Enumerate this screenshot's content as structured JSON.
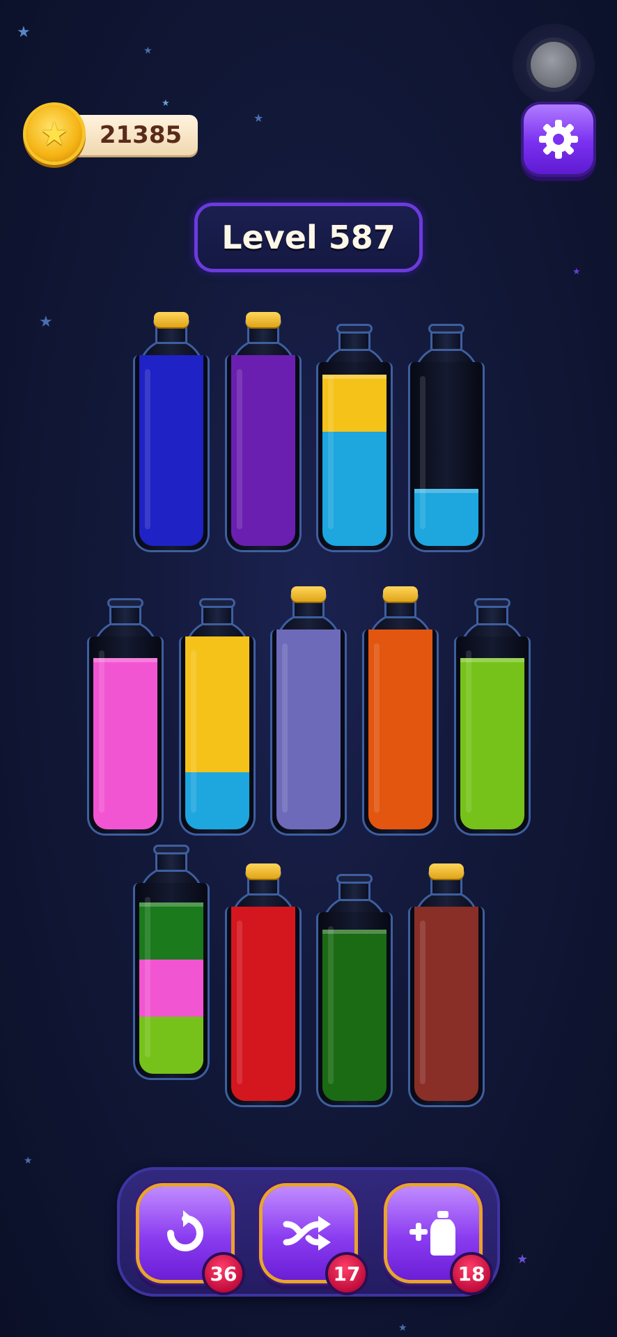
{
  "header": {
    "coins": "21385",
    "level_label": "Level 587"
  },
  "icons": {
    "coin": "star-coin-icon",
    "settings": "gear-icon",
    "undo": "undo-icon",
    "shuffle": "shuffle-icon",
    "add_bottle": "add-bottle-icon"
  },
  "tools": {
    "undo_count": "36",
    "shuffle_count": "17",
    "add_bottle_count": "18"
  },
  "bottles": [
    {
      "layers": [
        "#1f22c4",
        "#1f22c4",
        "#1f22c4",
        "#1f22c4"
      ],
      "corked": true
    },
    {
      "layers": [
        "#6a1fb0",
        "#6a1fb0",
        "#6a1fb0",
        "#6a1fb0"
      ],
      "corked": true
    },
    {
      "layers": [
        "#1ea6df",
        "#1ea6df",
        "#f5c21a"
      ],
      "corked": false
    },
    {
      "layers": [
        "#1ea6df"
      ],
      "corked": false
    },
    {
      "layers": [
        "#f255d2",
        "#f255d2",
        "#f255d2"
      ],
      "corked": false
    },
    {
      "layers": [
        "#1ea6df",
        "#f5c21a",
        "#f5c21a",
        "#f5c21a"
      ],
      "corked": false
    },
    {
      "layers": [
        "#6e6aba",
        "#6e6aba",
        "#6e6aba",
        "#6e6aba"
      ],
      "corked": true
    },
    {
      "layers": [
        "#e2560f",
        "#e2560f",
        "#e2560f",
        "#e2560f"
      ],
      "corked": true
    },
    {
      "layers": [
        "#76c21b",
        "#76c21b",
        "#76c21b"
      ],
      "corked": false
    },
    {
      "layers": [
        "#76c21b",
        "#f255d2",
        "#1b7a1c"
      ],
      "corked": false
    },
    {
      "layers": [
        "#d4161f",
        "#d4161f",
        "#d4161f",
        "#d4161f"
      ],
      "corked": true
    },
    {
      "layers": [
        "#1b6a14",
        "#1b6a14",
        "#1b6a14"
      ],
      "corked": false
    },
    {
      "layers": [
        "#8a2e28",
        "#8a2e28",
        "#8a2e28",
        "#8a2e28"
      ],
      "corked": true
    }
  ]
}
